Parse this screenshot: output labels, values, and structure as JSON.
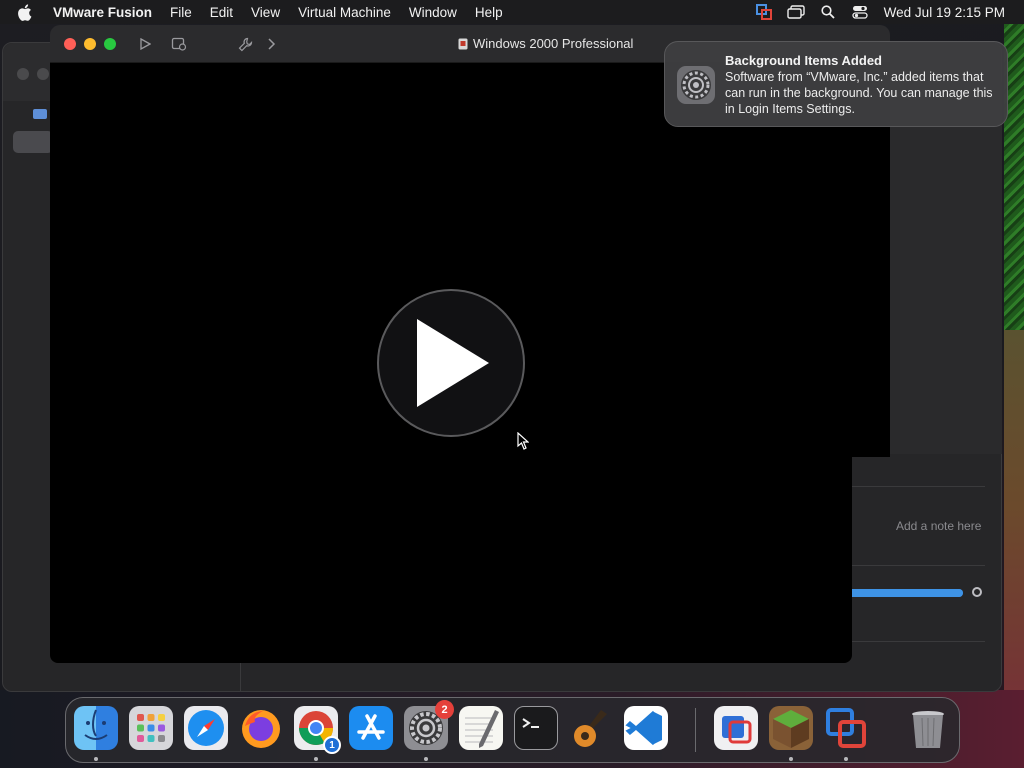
{
  "menubar": {
    "app_name": "VMware Fusion",
    "menus": [
      "File",
      "Edit",
      "View",
      "Virtual Machine",
      "Window",
      "Help"
    ],
    "tray_icons": [
      "vmware-tray-icon",
      "screen-mirroring-icon",
      "spotlight-search-icon",
      "control-center-icon"
    ],
    "clock": "Wed Jul 19  2:15 PM"
  },
  "vm_window": {
    "title": "Windows 2000 Professional",
    "toolbar": [
      "play-icon",
      "snapshot-icon",
      "settings-wrench-icon",
      "forward-chevron-icon"
    ]
  },
  "notification": {
    "title": "Background Items Added",
    "body": "Software from “VMware, Inc.” added items that can run in the background. You can manage this in Login Items Settings."
  },
  "library_panel": {
    "note_placeholder": "Add a note here"
  },
  "dock": {
    "apps": [
      {
        "name": "Finder",
        "running": true
      },
      {
        "name": "Launchpad",
        "running": false
      },
      {
        "name": "Safari",
        "running": false
      },
      {
        "name": "Firefox",
        "running": false
      },
      {
        "name": "Google Chrome",
        "running": true,
        "sub_badge": "1"
      },
      {
        "name": "App Store",
        "running": false
      },
      {
        "name": "System Settings",
        "running": true,
        "badge": "2"
      },
      {
        "name": "TextEdit",
        "running": false
      },
      {
        "name": "Terminal",
        "running": false
      },
      {
        "name": "GarageBand",
        "running": false
      },
      {
        "name": "Visual Studio Code",
        "running": false
      },
      {
        "name": "Parallels",
        "running": false
      },
      {
        "name": "Minecraft",
        "running": true
      },
      {
        "name": "VMware Fusion",
        "running": true
      },
      {
        "name": "Trash",
        "running": false
      }
    ]
  },
  "colors": {
    "close": "#ff5f57",
    "minimize": "#febc2e",
    "zoom": "#28c840",
    "accent": "#3e93e6"
  }
}
